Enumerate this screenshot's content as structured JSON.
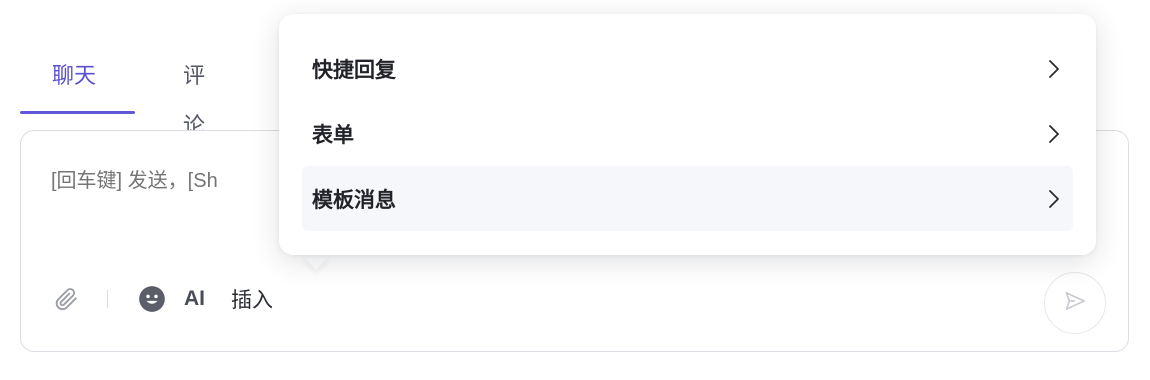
{
  "tabs": {
    "chat": "聊天",
    "comment": "评论"
  },
  "composer": {
    "placeholder": "[回车键] 发送，[Sh",
    "ai_label": "AI",
    "insert_label": "插入"
  },
  "menu": {
    "items": [
      {
        "label": "快捷回复",
        "chevron": ">"
      },
      {
        "label": "表单",
        "chevron": ">"
      },
      {
        "label": "模板消息",
        "chevron": ">"
      }
    ]
  },
  "colors": {
    "accent": "#6257d8",
    "border": "#dcdde3",
    "placeholder": "#a7a9b3"
  },
  "icons": [
    "paperclip-icon",
    "emoji-icon",
    "send-icon",
    "chevron-right-icon"
  ]
}
